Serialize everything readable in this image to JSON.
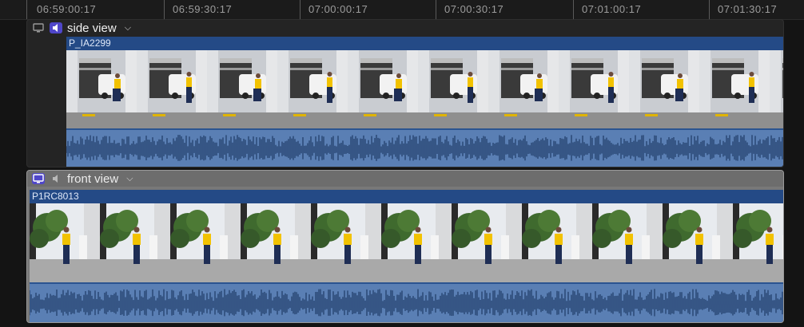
{
  "ruler": {
    "timecodes": [
      "06:59:00:17",
      "06:59:30:17",
      "07:00:00:17",
      "07:00:30:17",
      "07:01:00:17",
      "07:01:30:17"
    ]
  },
  "angles": [
    {
      "title": "side view",
      "clip_name": "P_IA2299",
      "video_monitor_active": false,
      "audio_monitor_active": true,
      "icons": {
        "video": "monitor-icon",
        "audio": "speaker-icon",
        "menu": "chevron-down-icon"
      }
    },
    {
      "title": "front view",
      "clip_name": "P1RC8013",
      "video_monitor_active": true,
      "audio_monitor_active": false,
      "icons": {
        "video": "monitor-icon",
        "audio": "speaker-icon",
        "menu": "chevron-down-icon"
      }
    }
  ],
  "colors": {
    "clip_blue": "#2b5490",
    "waveform_blue": "#5a7fb4",
    "active_monitor": "#4f46c9",
    "selected_angle_bg": "#787878"
  }
}
